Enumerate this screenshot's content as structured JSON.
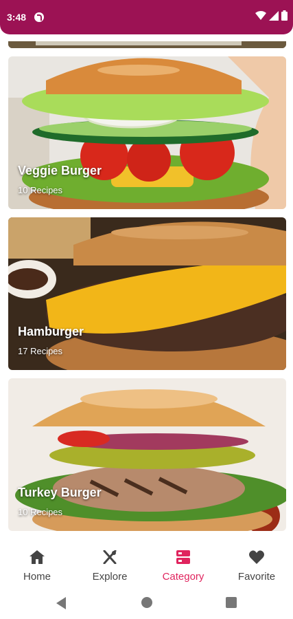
{
  "status": {
    "time": "3:48"
  },
  "categories": [
    {
      "title": "Veggie Burger",
      "count": "10 Recipes"
    },
    {
      "title": "Hamburger",
      "count": "17 Recipes"
    },
    {
      "title": "Turkey Burger",
      "count": "10 Recipes"
    }
  ],
  "nav": [
    {
      "label": "Home",
      "icon": "home-icon"
    },
    {
      "label": "Explore",
      "icon": "fork-knife-icon"
    },
    {
      "label": "Category",
      "icon": "category-icon"
    },
    {
      "label": "Favorite",
      "icon": "heart-icon"
    }
  ],
  "colors": {
    "status_bar": "#9c1254",
    "accent": "#e0245e"
  }
}
